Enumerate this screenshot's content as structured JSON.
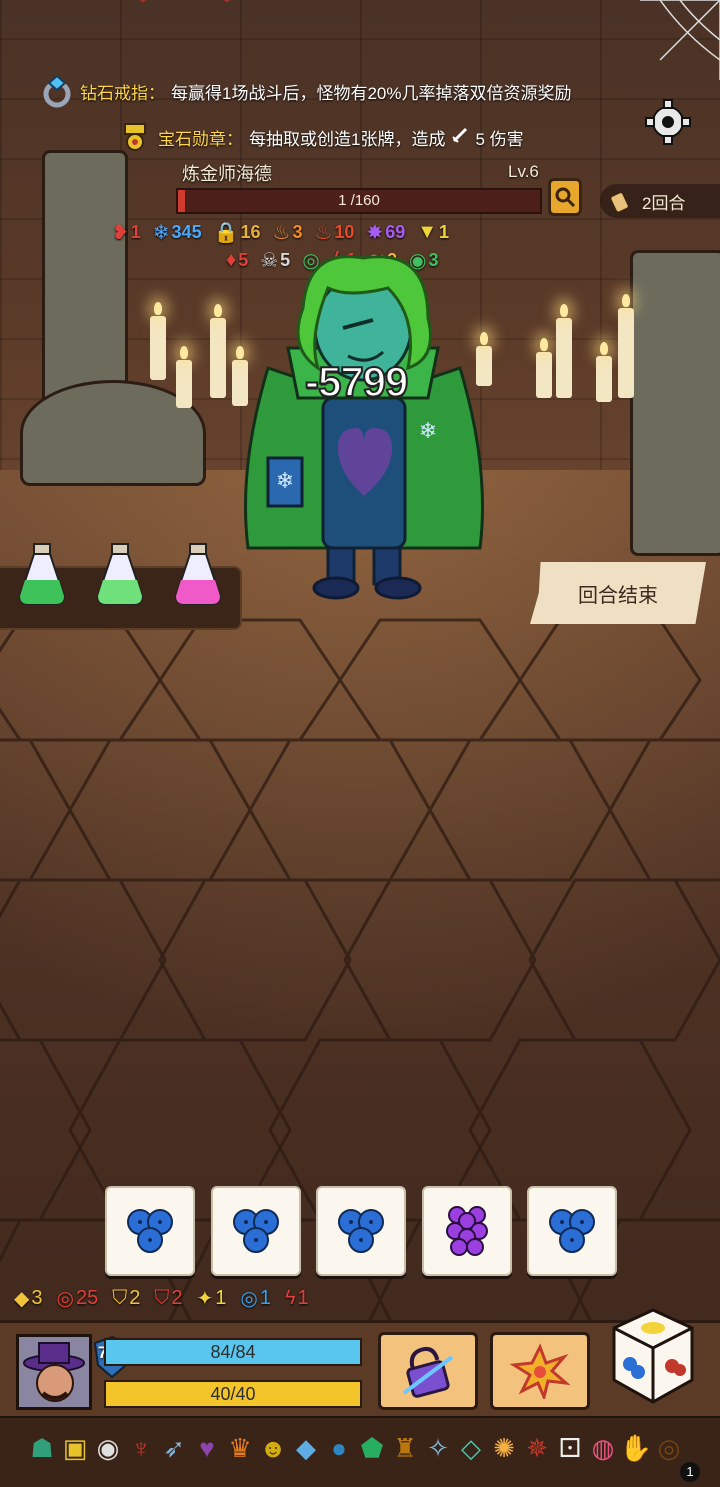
{
  "relics_buffs": [
    {
      "name": "钻石戒指：",
      "desc": "每赢得1场战斗后，怪物有20%几率掉落双倍资源奖励",
      "icon": "diamond-ring-icon"
    },
    {
      "name": "宝石勋章：",
      "desc_before": "每抽取或创造1张牌，造成",
      "desc_after": "5 伤害",
      "icon": "gem-medal-icon"
    }
  ],
  "enemy": {
    "name": "炼金师海德",
    "level": "Lv.6",
    "hp_text": "1 /160",
    "hp_fraction": 0.00625,
    "damage_popup": "-5799",
    "status_row1": [
      {
        "icon": "bleed-icon",
        "value": "1",
        "color": "#e0403a"
      },
      {
        "icon": "snowflake-icon",
        "value": "345",
        "color": "#4aa8ff"
      },
      {
        "icon": "lock-icon",
        "value": "16",
        "color": "#e6b13a"
      },
      {
        "icon": "flame-orange-icon",
        "value": "3",
        "color": "#f08a2a"
      },
      {
        "icon": "fire-red-icon",
        "value": "10",
        "color": "#e84a2a"
      },
      {
        "icon": "splat-purple-icon",
        "value": "69",
        "color": "#a55cf0"
      },
      {
        "icon": "triangle-eye-icon",
        "value": "1",
        "color": "#f2d43a"
      }
    ],
    "status_row2": [
      {
        "icon": "blood-drop-icon",
        "value": "5",
        "color": "#e0403a"
      },
      {
        "icon": "skull-icon",
        "value": "5",
        "color": "#d8d8d8"
      },
      {
        "icon": "swirl-green-icon",
        "value": "",
        "color": "#3fbf5f"
      },
      {
        "icon": "claw-red-icon",
        "value": "1",
        "color": "#e0403a"
      },
      {
        "icon": "scratch-yellow-icon",
        "value": "2",
        "color": "#f2b43a"
      },
      {
        "icon": "spiral-green-icon",
        "value": "3",
        "color": "#3fbf5f"
      }
    ]
  },
  "turn_counter": {
    "label": "2回合"
  },
  "end_turn_button": {
    "label": "回合结束"
  },
  "potions": [
    {
      "color": "#3ec25a",
      "name": "green-potion"
    },
    {
      "color": "#6fe07a",
      "name": "light-green-potion"
    },
    {
      "color": "#f05ac8",
      "name": "pink-potion"
    }
  ],
  "dice_row": [
    {
      "face": "blueberry",
      "color": "#2b6fd6"
    },
    {
      "face": "blueberry",
      "color": "#2b6fd6"
    },
    {
      "face": "blueberry",
      "color": "#2b6fd6"
    },
    {
      "face": "grape",
      "color": "#9b3fe0"
    },
    {
      "face": "blueberry",
      "color": "#2b6fd6"
    }
  ],
  "player": {
    "block": "762",
    "hp_text": "84/84",
    "energy_text": "40/40",
    "status": [
      {
        "icon": "diamond-up-icon",
        "value": "3",
        "color": "#f2c33a"
      },
      {
        "icon": "spiral-red-icon",
        "value": "25",
        "color": "#e0403a"
      },
      {
        "icon": "shield-yellow-icon",
        "value": "2",
        "color": "#f2c33a"
      },
      {
        "icon": "shield-red-icon",
        "value": "2",
        "color": "#e0403a"
      },
      {
        "icon": "star-wand-icon",
        "value": "1",
        "color": "#f2d43a"
      },
      {
        "icon": "target-blue-icon",
        "value": "1",
        "color": "#3aa0f0"
      },
      {
        "icon": "claw-red-icon",
        "value": "1",
        "color": "#e0403a"
      }
    ]
  },
  "relic_bar": {
    "badge": "1",
    "items": [
      "jade-mask-icon",
      "gold-box-icon",
      "eye-orb-icon",
      "horn-icon",
      "drill-icon",
      "lightning-heart-icon",
      "crown-icon",
      "totem-mask-icon",
      "diamond-icon",
      "orb-icon",
      "shield-gem-icon",
      "goblet-icon",
      "compass-icon",
      "crystal-icon",
      "shell-icon",
      "octopus-icon",
      "dice-card-icon",
      "egg-icon",
      "claw-icon",
      "button-icon"
    ]
  }
}
